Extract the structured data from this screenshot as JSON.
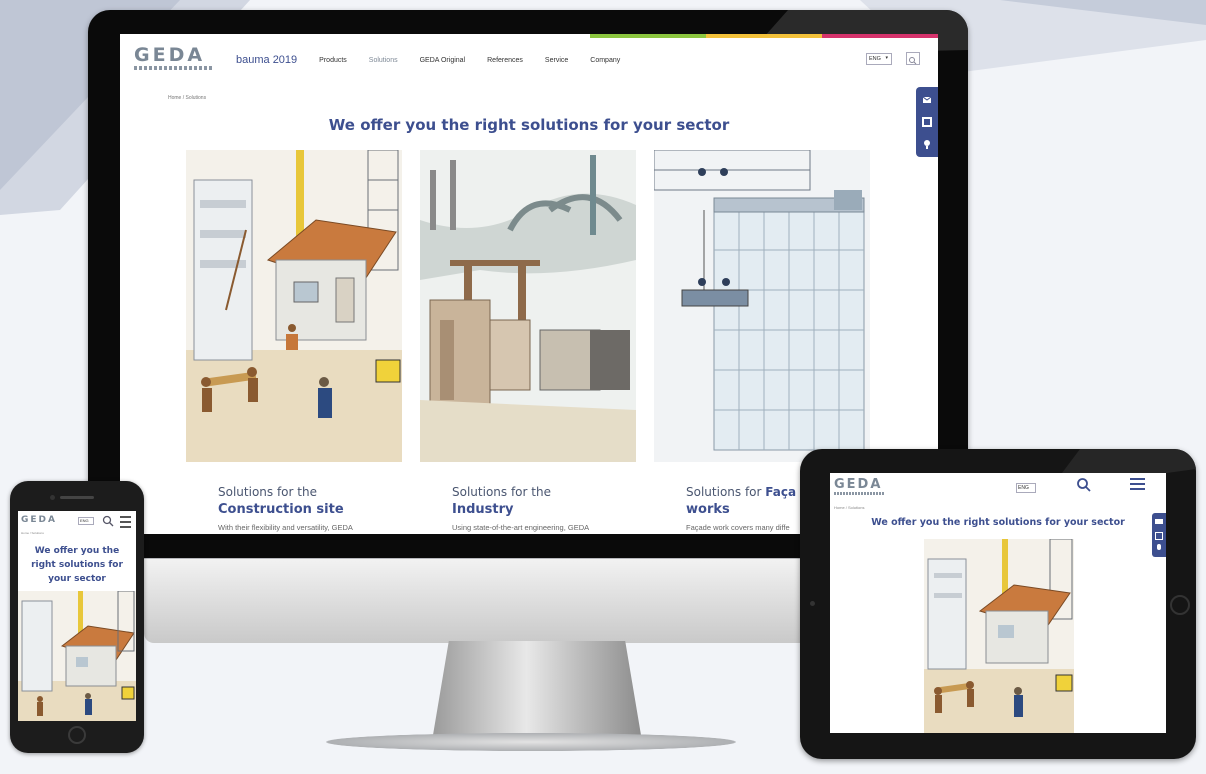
{
  "colors": {
    "brand_blue": "#3d4f8f",
    "logo_gray": "#7a8795",
    "bar_green": "#8cc63f",
    "bar_yellow": "#f3c13a",
    "bar_magenta": "#d6336c",
    "bar_blue": "#3d4f8f"
  },
  "desktop": {
    "logo": {
      "text": "GEDA"
    },
    "nav": {
      "bauma": "bauma 2019",
      "items": [
        "Products",
        "Solutions",
        "GEDA Original",
        "References",
        "Service",
        "Company"
      ],
      "active": "Solutions"
    },
    "language": "ENG",
    "search_icon": "search-icon",
    "breadcrumb": "Home / Solutions",
    "title": "We offer you the right solutions for your sector",
    "side_toolbar_icons": [
      "mail-icon",
      "document-icon",
      "lightbulb-icon"
    ],
    "cards": [
      {
        "title_prefix": "Solutions for the",
        "title_bold": "Construction site",
        "desc": "With their flexibility and versatility, GEDA"
      },
      {
        "title_prefix": "Solutions for the",
        "title_bold": "Industry",
        "desc": "Using state-of-the-art engineering, GEDA"
      },
      {
        "title_prefix": "Solutions for",
        "title_bold_inline": "Faça",
        "title_bold": "works",
        "desc": "Façade work covers many diffe"
      }
    ]
  },
  "phone": {
    "logo": "GEDA",
    "language": "ENG",
    "breadcrumb": "Home / Solutions",
    "title": "We offer you the right solutions for your sector"
  },
  "tablet": {
    "logo": "GEDA",
    "language": "ENG",
    "breadcrumb": "Home / Solutions",
    "title": "We offer you the right solutions for your sector"
  }
}
